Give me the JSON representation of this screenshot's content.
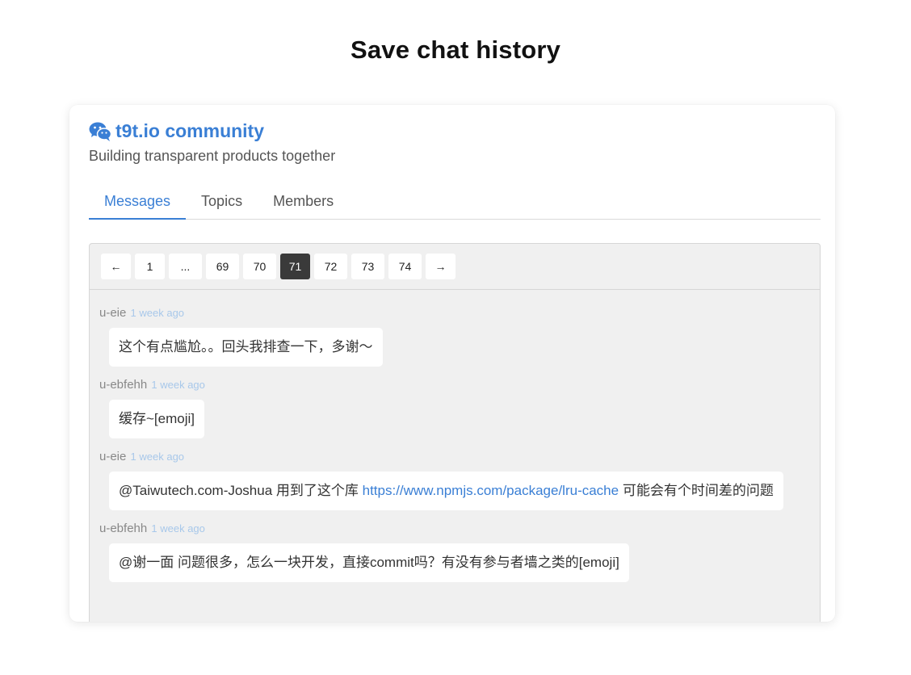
{
  "page_title": "Save chat history",
  "community": {
    "name": "t9t.io community",
    "tagline": "Building transparent products together",
    "icon": "wechat-icon",
    "accent_color": "#3a7fd5"
  },
  "tabs": [
    {
      "label": "Messages",
      "active": true
    },
    {
      "label": "Topics",
      "active": false
    },
    {
      "label": "Members",
      "active": false
    }
  ],
  "pagination": {
    "prev": "←",
    "next": "→",
    "pages": [
      "1",
      "...",
      "69",
      "70",
      "71",
      "72",
      "73",
      "74"
    ],
    "current": "71"
  },
  "messages": [
    {
      "user": "u-eie",
      "time": "1 week ago",
      "text": "这个有点尴尬。。回头我排查一下，多谢～"
    },
    {
      "user": "u-ebfehh",
      "time": "1 week ago",
      "text": "缓存~[emoji]"
    },
    {
      "user": "u-eie",
      "time": "1 week ago",
      "text_before": "@Taiwutech.com-Joshua  用到了这个库 ",
      "link": "https://www.npmjs.com/package/lru-cache",
      "text_after": " 可能会有个时间差的问题"
    },
    {
      "user": "u-ebfehh",
      "time": "1 week ago",
      "text": "@谢一面 问题很多，怎么一块开发，直接commit吗？有没有参与者墙之类的[emoji]"
    }
  ]
}
